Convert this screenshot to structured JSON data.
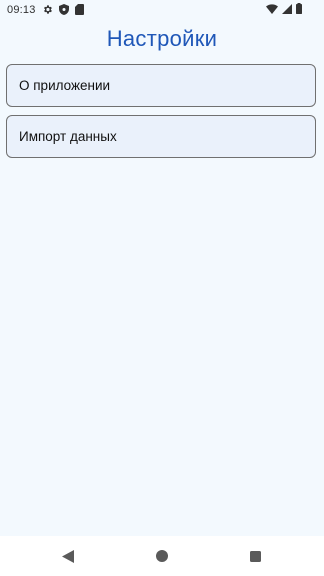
{
  "status_bar": {
    "time": "09:13",
    "left_icons": [
      "settings-icon",
      "shield-icon",
      "sim-card-icon"
    ],
    "right_icons": [
      "wifi-icon",
      "signal-icon",
      "battery-icon"
    ]
  },
  "page": {
    "title": "Настройки"
  },
  "menu": {
    "items": [
      {
        "label": "О приложении"
      },
      {
        "label": "Импорт данных"
      }
    ]
  },
  "nav_bar": {
    "buttons": [
      "back-icon",
      "home-icon",
      "recents-icon"
    ]
  },
  "colors": {
    "background": "#F3F9FE",
    "title": "#1F57B8",
    "card_background": "#EAF1FB",
    "card_border": "#707070"
  }
}
